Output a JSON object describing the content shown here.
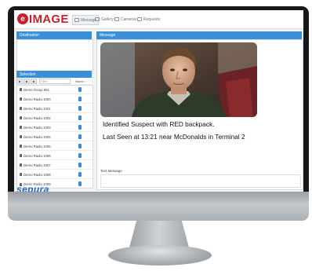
{
  "app": {
    "logo_mark": "e",
    "logo_text": "IMAGE",
    "brand_color": "#c8202a",
    "accent_color": "#3a8fd6"
  },
  "nav": {
    "tabs": [
      {
        "label": "Message",
        "icon": "message-icon",
        "active": true
      },
      {
        "label": "Gallery",
        "icon": "gallery-icon",
        "active": false
      },
      {
        "label": "Cameras",
        "icon": "camera-icon",
        "active": false
      },
      {
        "label": "Requests",
        "icon": "requests-icon",
        "active": false
      }
    ]
  },
  "destination": {
    "title": "Destination"
  },
  "selection": {
    "title": "Selection",
    "filter_placeholder": "Filter",
    "sort_label": "Name ↓"
  },
  "radios": [
    {
      "name": "Demo Group 991",
      "type": "group"
    },
    {
      "name": "Demo Radio 1000",
      "type": "radio"
    },
    {
      "name": "Demo Radio 1001",
      "type": "radio"
    },
    {
      "name": "Demo Radio 1002",
      "type": "radio"
    },
    {
      "name": "Demo Radio 1003",
      "type": "radio"
    },
    {
      "name": "Demo Radio 1004",
      "type": "radio"
    },
    {
      "name": "Demo Radio 1005",
      "type": "radio"
    },
    {
      "name": "Demo Radio 1006",
      "type": "radio"
    },
    {
      "name": "Demo Radio 1007",
      "type": "radio"
    },
    {
      "name": "Demo Radio 1008",
      "type": "radio"
    },
    {
      "name": "Demo Radio 1009",
      "type": "radio"
    }
  ],
  "message": {
    "title": "Message",
    "line1": "Identified Suspect with RED backpack.",
    "line2": "Last Seen at 13:21 near McDonalds in Terminal 2"
  },
  "text_message": {
    "label": "Text Message"
  },
  "footer": {
    "brand": "sepura",
    "brand_color": "#1f66b8"
  }
}
